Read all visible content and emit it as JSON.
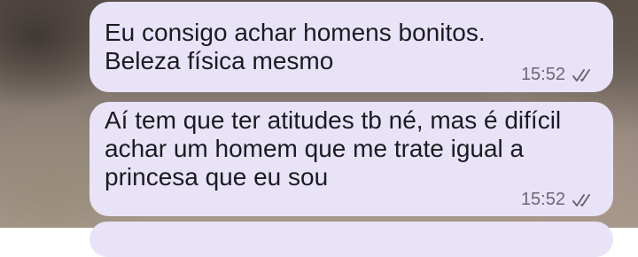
{
  "messages": [
    {
      "text": "Eu consigo achar homens bonitos.\nBeleza física mesmo",
      "time": "15:52",
      "status_icon": "double-check-icon"
    },
    {
      "text": "Aí tem que ter atitudes tb né, mas é difícil\nachar um homem que me trate igual a\nprincesa que eu sou",
      "time": "15:52",
      "status_icon": "double-check-icon"
    }
  ],
  "colors": {
    "bubble": "#e9e3f8",
    "text": "#1c1b21",
    "meta": "#6c6675"
  }
}
